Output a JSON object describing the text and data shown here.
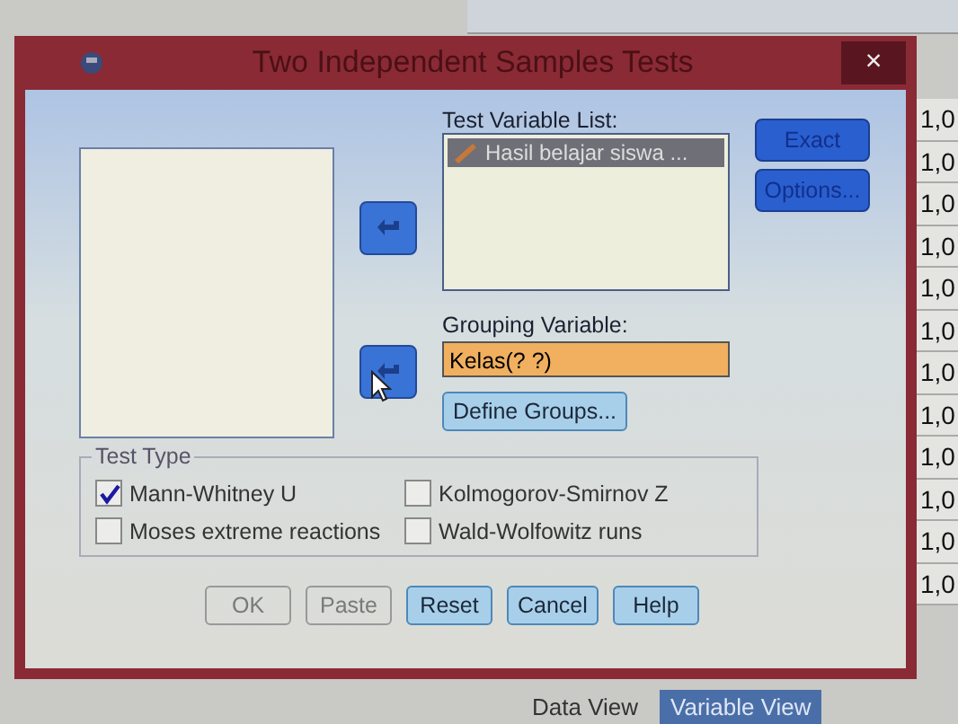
{
  "window": {
    "title": "Two Independent Samples Tests",
    "close": "×"
  },
  "test_variable_list": {
    "label": "Test Variable List:",
    "items": [
      {
        "name": "Hasil belajar siswa ...",
        "selected": true
      }
    ]
  },
  "grouping_variable": {
    "label": "Grouping Variable:",
    "value": "Kelas(? ?)"
  },
  "define_groups_button": "Define Groups...",
  "side_buttons": [
    "Exact",
    "Options..."
  ],
  "test_type": {
    "label": "Test Type",
    "options": [
      {
        "label": "Mann-Whitney U",
        "checked": true
      },
      {
        "label": "Kolmogorov-Smirnov Z",
        "checked": false
      },
      {
        "label": "Moses extreme reactions",
        "checked": false
      },
      {
        "label": "Wald-Wolfowitz runs",
        "checked": false
      }
    ]
  },
  "buttons": [
    {
      "label": "OK",
      "disabled": true
    },
    {
      "label": "Paste",
      "disabled": true
    },
    {
      "label": "Reset",
      "disabled": false
    },
    {
      "label": "Cancel",
      "disabled": false
    },
    {
      "label": "Help",
      "disabled": false
    }
  ],
  "data_cells": [
    "1,0",
    "1,0",
    "1,0",
    "1,0",
    "1,0",
    "1,0",
    "1,0",
    "1,0",
    "1,0",
    "1,0",
    "1,0",
    "1,0"
  ],
  "view_tabs": [
    {
      "label": "Data View",
      "selected": false
    },
    {
      "label": "Variable View",
      "selected": true
    }
  ]
}
